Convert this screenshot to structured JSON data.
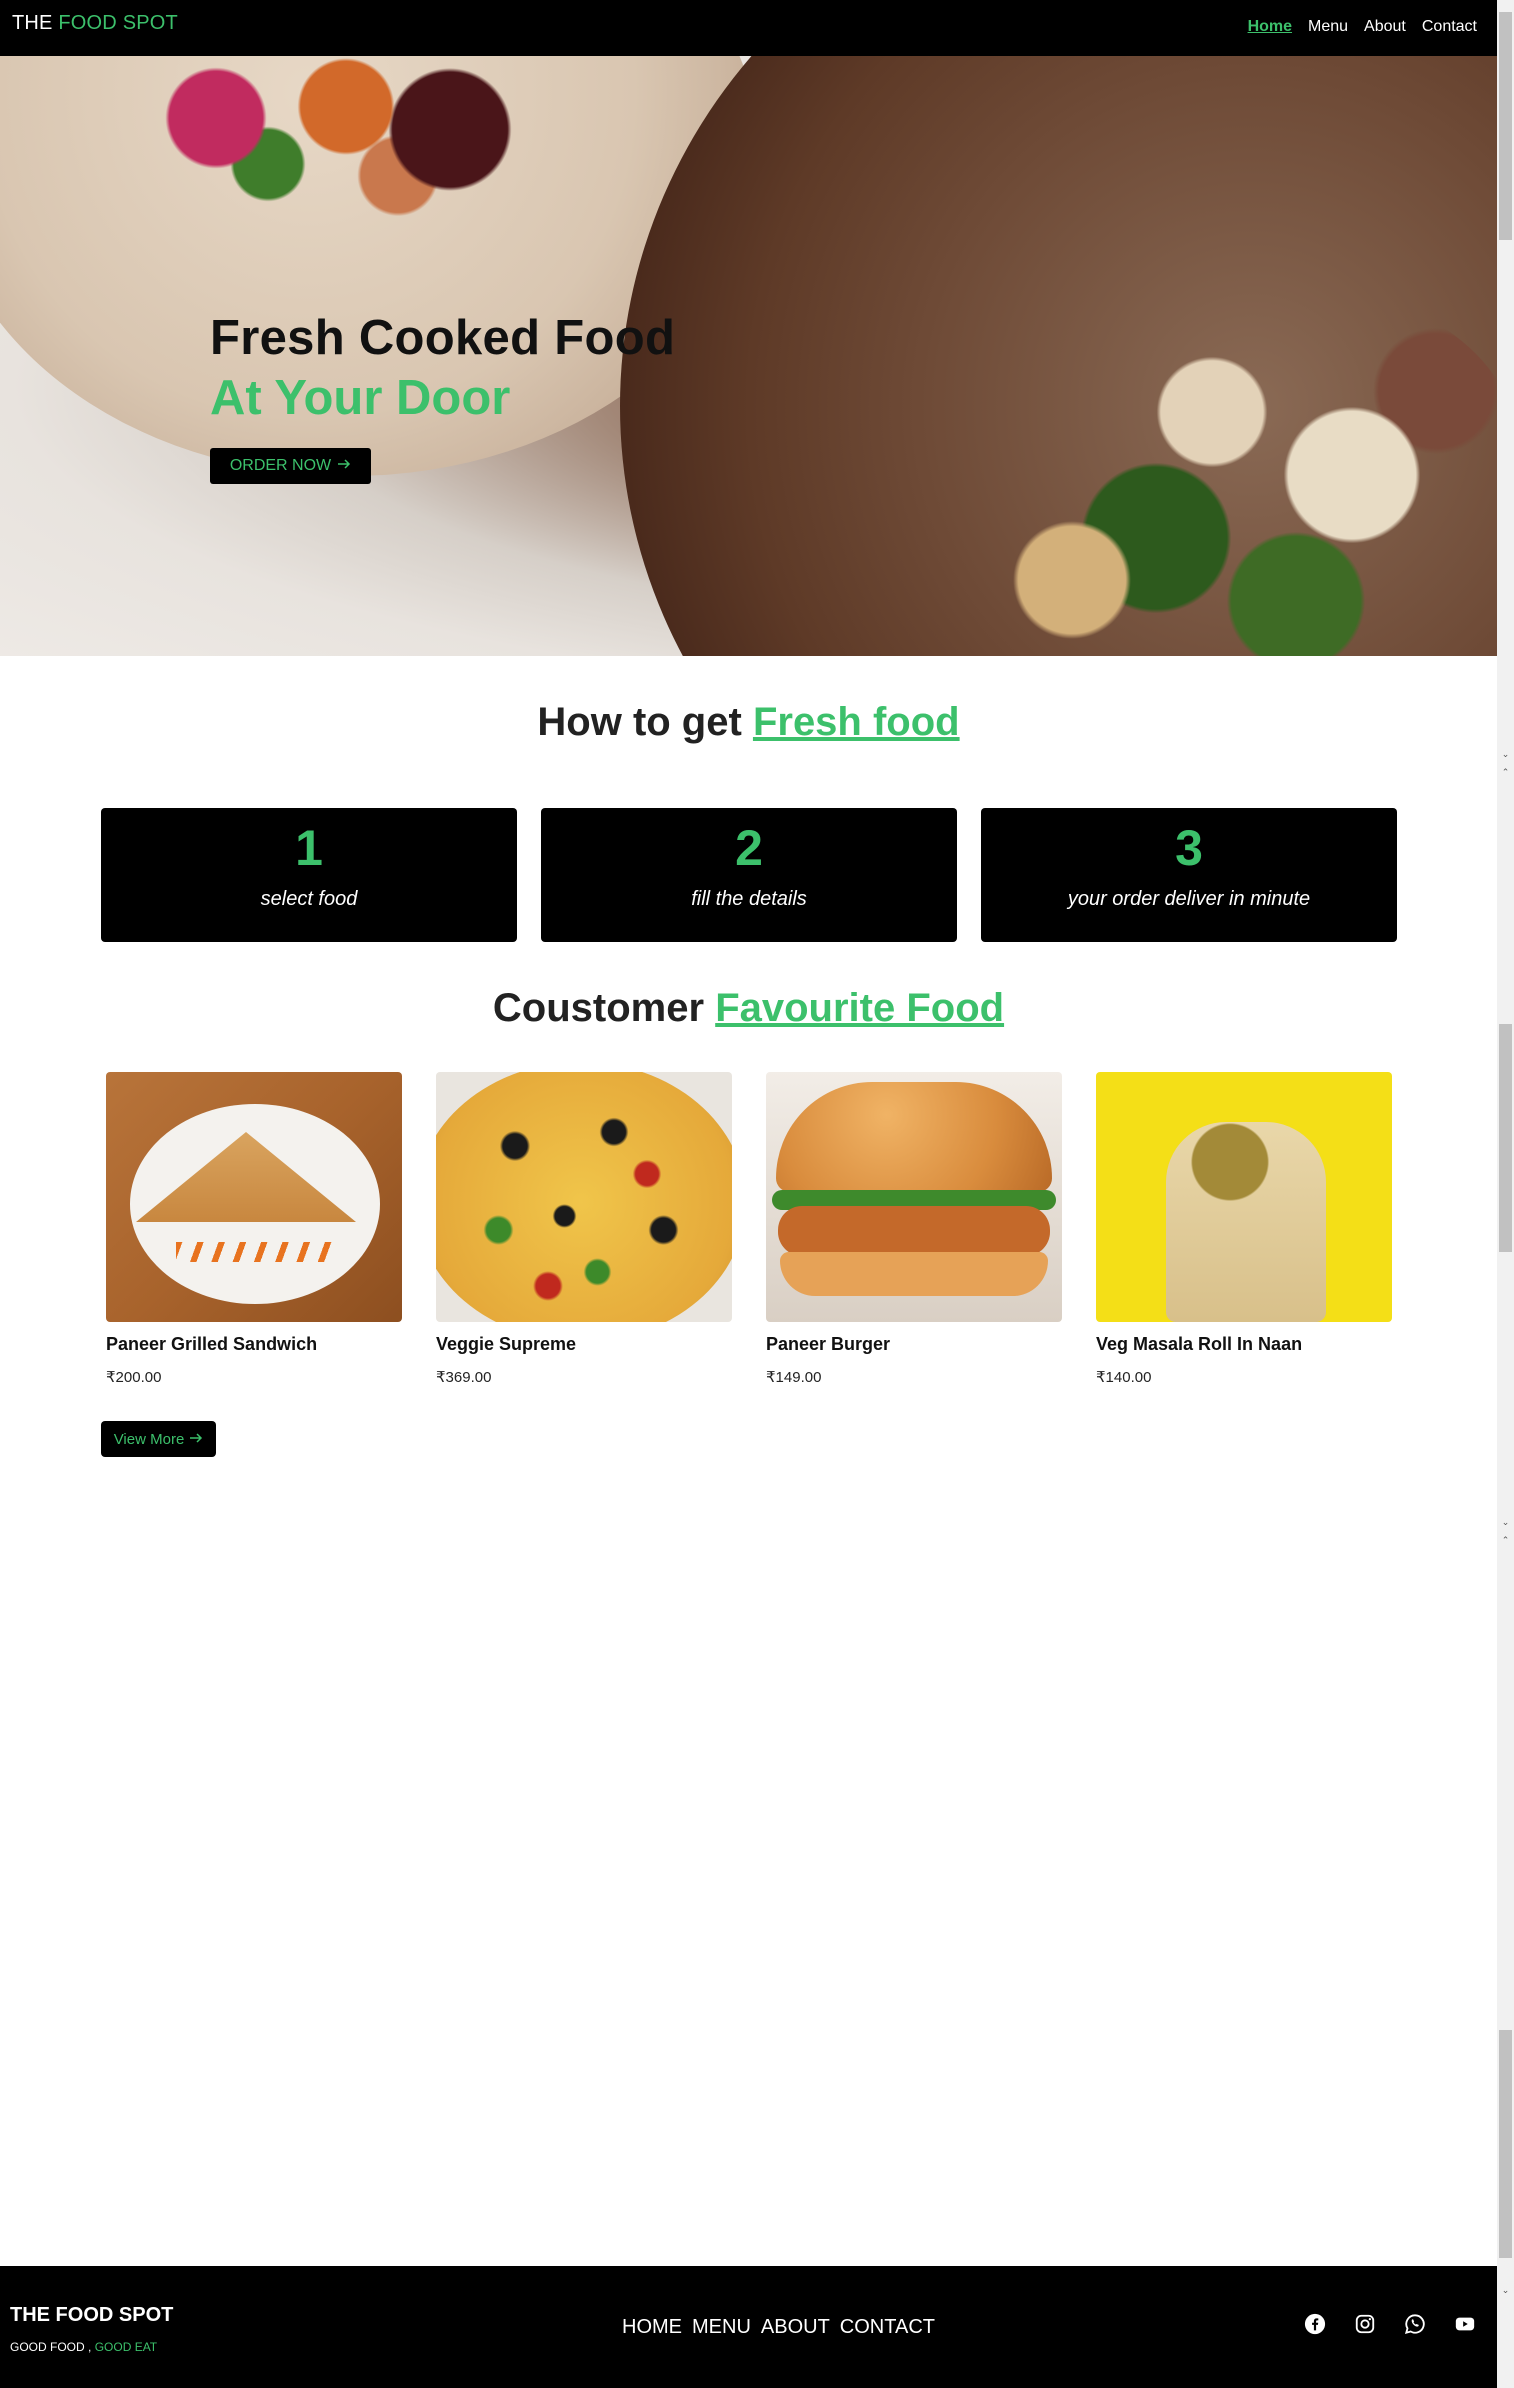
{
  "header": {
    "brand_prefix": "THE",
    "brand_accent": "FOOD SPOT",
    "nav": [
      "Home",
      "Menu",
      "About",
      "Contact"
    ]
  },
  "hero": {
    "title": "Fresh Cooked Food",
    "subtitle": "At Your Door",
    "cta": "ORDER NOW"
  },
  "how": {
    "title_prefix": "How to get",
    "title_accent": "Fresh food",
    "steps": [
      {
        "num": "1",
        "text": "select food"
      },
      {
        "num": "2",
        "text": "fill the details"
      },
      {
        "num": "3",
        "text": "your order deliver in minute"
      }
    ]
  },
  "favourites": {
    "title_prefix": "Coustomer",
    "title_accent": "Favourite Food",
    "items": [
      {
        "name": "Paneer Grilled Sandwich",
        "price": "₹200.00"
      },
      {
        "name": "Veggie Supreme",
        "price": "₹369.00"
      },
      {
        "name": "Paneer Burger",
        "price": "₹149.00"
      },
      {
        "name": "Veg Masala Roll In Naan",
        "price": "₹140.00"
      }
    ],
    "view_more": "View More"
  },
  "footer": {
    "brand": "THE FOOD SPOT",
    "tag_prefix": "GOOD FOOD ,",
    "tag_accent": "GOOD EAT",
    "nav": [
      "HOME",
      "MENU",
      "ABOUT",
      "CONTACT"
    ],
    "social_icons": [
      "facebook-icon",
      "instagram-icon",
      "whatsapp-icon",
      "youtube-icon"
    ]
  },
  "colors": {
    "accent": "#3cc06b",
    "bar": "#000000"
  }
}
